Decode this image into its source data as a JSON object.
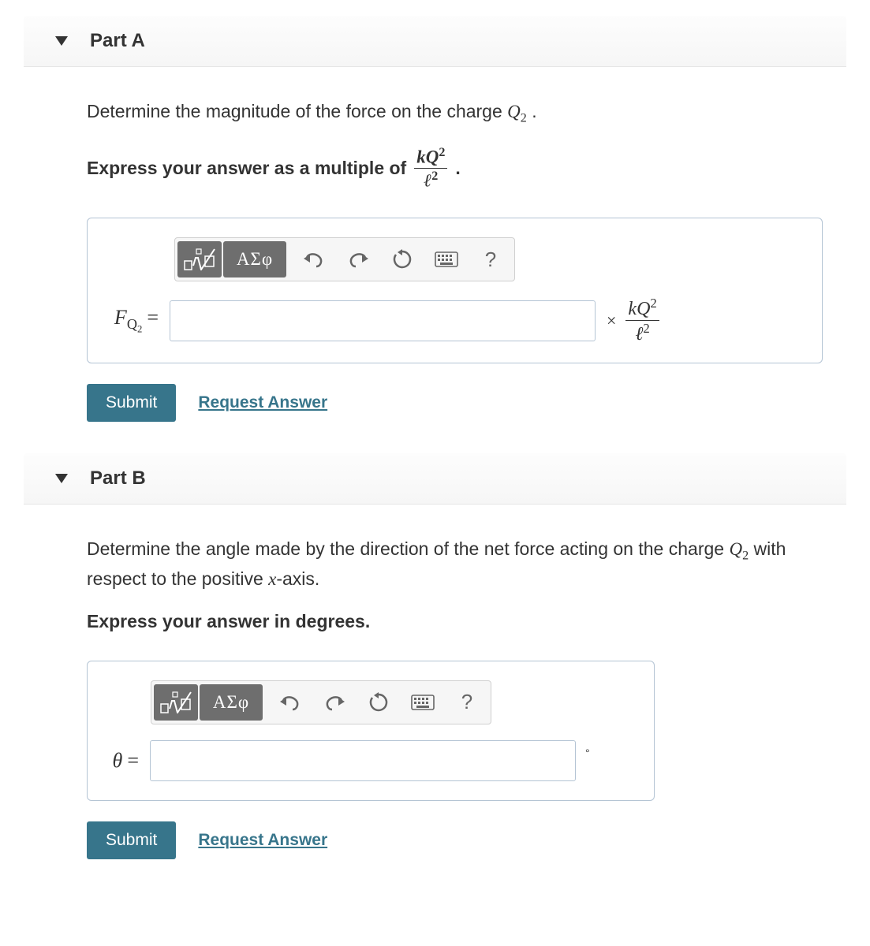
{
  "partA": {
    "title": "Part A",
    "prompt_pre": "Determine the magnitude of the force on the charge ",
    "prompt_var_base": "Q",
    "prompt_var_sub": "2",
    "prompt_post": " .",
    "express_pre": "Express your answer as a multiple of ",
    "frac_num_k": "k",
    "frac_num_Q": "Q",
    "frac_num_sup": "2",
    "frac_den_l": "ℓ",
    "frac_den_sup": "2",
    "express_post": " .",
    "lhs_F": "F",
    "lhs_sub_Q": "Q",
    "lhs_sub_2": "2",
    "equals": "=",
    "unit_times": "×",
    "greek_label": "ΑΣφ",
    "help_q": "?",
    "submit": "Submit",
    "request": "Request Answer",
    "input_value": ""
  },
  "partB": {
    "title": "Part B",
    "prompt_pre": "Determine the angle made by the direction of the net force acting on the charge ",
    "prompt_var_base": "Q",
    "prompt_var_sub": "2",
    "prompt_mid": " with respect to the positive ",
    "prompt_x": "x",
    "prompt_post": "-axis.",
    "express": "Express your answer in degrees.",
    "lhs_theta": "θ",
    "equals": "=",
    "unit_deg": "°",
    "greek_label": "ΑΣφ",
    "help_q": "?",
    "submit": "Submit",
    "request": "Request Answer",
    "input_value": ""
  }
}
